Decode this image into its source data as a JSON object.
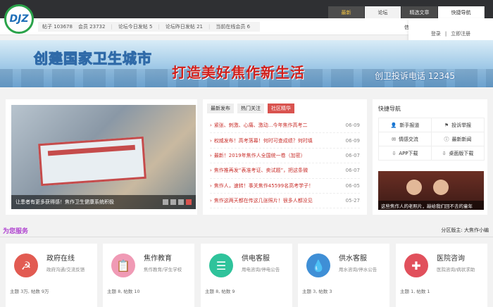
{
  "logo": {
    "text": "DJZ"
  },
  "nav": {
    "tabs": [
      {
        "label": "最新"
      },
      {
        "label": "论坛"
      },
      {
        "label": "精选文章"
      },
      {
        "label": "快捷导航"
      }
    ]
  },
  "stats": {
    "posts": "帖子 103678",
    "members": "会员 23732",
    "today": "论坛今日发帖 5",
    "yesterday": "论坛昨日发帖 21",
    "online": "当前在线会员 6"
  },
  "login": {
    "login": "登录",
    "sep": "|",
    "register": "立即注册"
  },
  "partial_text": "信",
  "banner": {
    "text1": "创建国家卫生城市",
    "text2": "打造美好焦作新生活",
    "text3": "创卫投诉电话 12345"
  },
  "slideshow": {
    "caption": "让患者有更多获得感！焦作卫生健康系统积极",
    "dots": 4,
    "active_index": 3
  },
  "news": {
    "tabs": [
      {
        "label": "最新发布"
      },
      {
        "label": "热门关注"
      },
      {
        "label": "社区精华"
      }
    ],
    "items": [
      {
        "title": "紧张、刺激、心痛、激动...今年焦作高考二",
        "date": "06-09"
      },
      {
        "title": "权威发布！高考落幕！何时可查成绩？何时填",
        "date": "06-09"
      },
      {
        "title": "最新！2019年焦作人全国统一卷（加密）",
        "date": "06-07"
      },
      {
        "title": "焦作推再发“表准考证、卖试题”，把这条微",
        "date": "06-07"
      },
      {
        "title": "焦作人，速转！事关焦作45599名高考学子！",
        "date": "06-05"
      },
      {
        "title": "焦作这两天都在传这几张照片！很多人都没见",
        "date": "05-27"
      }
    ]
  },
  "quick": {
    "title": "快捷导航",
    "items": [
      {
        "label": "新手报道",
        "icon": "user-icon",
        "glyph": "👤"
      },
      {
        "label": "投诉举报",
        "icon": "flag-icon",
        "glyph": "⚑"
      },
      {
        "label": "情感交流",
        "icon": "chat-icon",
        "glyph": "✉"
      },
      {
        "label": "最新新闻",
        "icon": "info-icon",
        "glyph": "ⓘ"
      },
      {
        "label": "APP下载",
        "icon": "download-icon",
        "glyph": "⇩"
      },
      {
        "label": "桌面版下载",
        "icon": "download-icon",
        "glyph": "⇩"
      }
    ],
    "image_caption": "这些焦作人的老照片，敲给我们回不去的童年"
  },
  "services": {
    "heading": "为您服务",
    "moderator": "分区版主: 大焦作小编",
    "items": [
      {
        "name": "政府在线",
        "desc": "政府沟通/交流反馈",
        "stats": "主题 3万, 帖数 9万",
        "color": "#e25b52",
        "glyph": "☭"
      },
      {
        "name": "焦作教育",
        "desc": "焦作教育/学生学校",
        "stats": "主题 8, 帖数 10",
        "color": "#f09ab5",
        "glyph": "📋"
      },
      {
        "name": "供电客服",
        "desc": "用电咨询/停电公告",
        "stats": "主题 8, 帖数 9",
        "color": "#2fc39b",
        "glyph": "☰"
      },
      {
        "name": "供水客服",
        "desc": "用水咨询/停水公告",
        "stats": "主题 3, 帖数 3",
        "color": "#3f8fd6",
        "glyph": "💧"
      },
      {
        "name": "医院咨询",
        "desc": "医院咨询/病状求助",
        "stats": "主题 1, 帖数 1",
        "color": "#e1505c",
        "glyph": "✚"
      }
    ]
  }
}
